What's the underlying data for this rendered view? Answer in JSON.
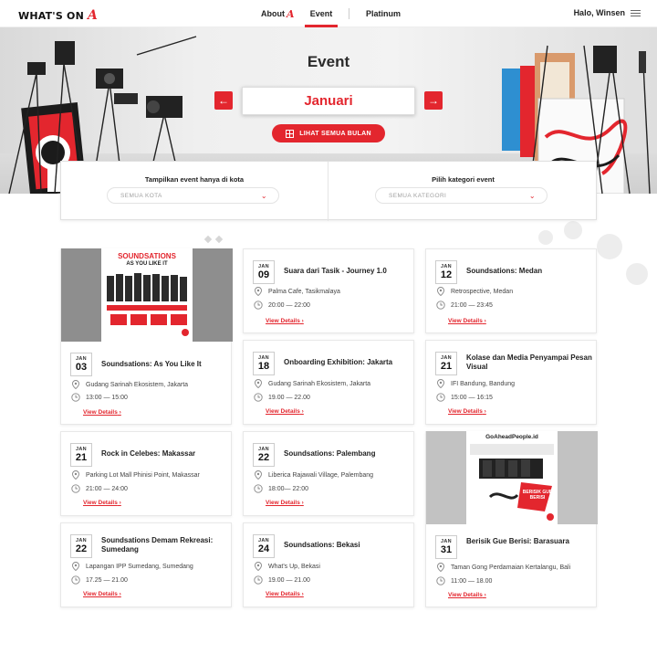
{
  "nav": {
    "logo_text": "WHAT'S ON",
    "logo_mark": "A",
    "about_label": "About",
    "about_mark": "A",
    "event_label": "Event",
    "platinum_label": "Platinum",
    "user_label": "Halo, Winsen",
    "menu_icon": "hamburger-icon"
  },
  "hero": {
    "title": "Event",
    "month": "Januari",
    "prev_icon": "arrow-left-icon",
    "next_icon": "arrow-right-icon",
    "all_months_label": "LIHAT SEMUA BULAN"
  },
  "filters": {
    "city_label": "Tampilkan event hanya di kota",
    "city_value": "SEMUA KOTA",
    "category_label": "Pilih kategori event",
    "category_value": "SEMUA KATEGORI"
  },
  "view_label": "View Details",
  "events": [
    {
      "month": "JAN",
      "day": "03",
      "title": "Soundsations: As You Like It",
      "venue": "Gudang Sarinah Ekosistem, Jakarta",
      "time": "13:00 — 15:00",
      "poster": {
        "headline": "SOUNDSATIONS",
        "sub": "AS YOU LIKE IT"
      }
    },
    {
      "month": "JAN",
      "day": "09",
      "title": "Suara dari Tasik - Journey 1.0",
      "venue": "Palma Cafe, Tasikmalaya",
      "time": "20:00 — 22:00"
    },
    {
      "month": "JAN",
      "day": "12",
      "title": "Soundsations: Medan",
      "venue": "Retrospective, Medan",
      "time": "21:00 — 23:45"
    },
    {
      "month": "JAN",
      "day": "18",
      "title": "Onboarding Exhibition: Jakarta",
      "venue": "Gudang Sarinah Ekosistem, Jakarta",
      "time": "19.00 — 22.00"
    },
    {
      "month": "JAN",
      "day": "21",
      "title": "Kolase dan Media Penyampai Pesan Visual",
      "venue": "IFI Bandung, Bandung",
      "time": "15:00 — 16:15"
    },
    {
      "month": "JAN",
      "day": "21",
      "title": "Rock in Celebes: Makassar",
      "venue": "Parking Lot Mall Phinisi Point, Makassar",
      "time": "21:00 — 24:00"
    },
    {
      "month": "JAN",
      "day": "22",
      "title": "Soundsations: Palembang",
      "venue": "Liberica Rajawali Village, Palembang",
      "time": "18:00— 22:00"
    },
    {
      "month": "JAN",
      "day": "31",
      "title": "Berisik Gue Berisi: Barasuara",
      "venue": "Taman Gong Perdamaian Kertalangu, Bali",
      "time": "11:00 — 18.00",
      "poster": {
        "headline": "GoAheadPeople.id",
        "sub": "BERISIK GUE BERISI"
      }
    },
    {
      "month": "JAN",
      "day": "22",
      "title": "Soundsations Demam Rekreasi: Sumedang",
      "venue": "Lapangan IPP Sumedang, Sumedang",
      "time": "17.25 — 21.00"
    },
    {
      "month": "JAN",
      "day": "24",
      "title": "Soundsations: Bekasi",
      "venue": "What's Up, Bekasi",
      "time": "19.00 — 21.00"
    }
  ],
  "colors": {
    "accent": "#e3262e",
    "text": "#222222",
    "muted": "#888888"
  }
}
